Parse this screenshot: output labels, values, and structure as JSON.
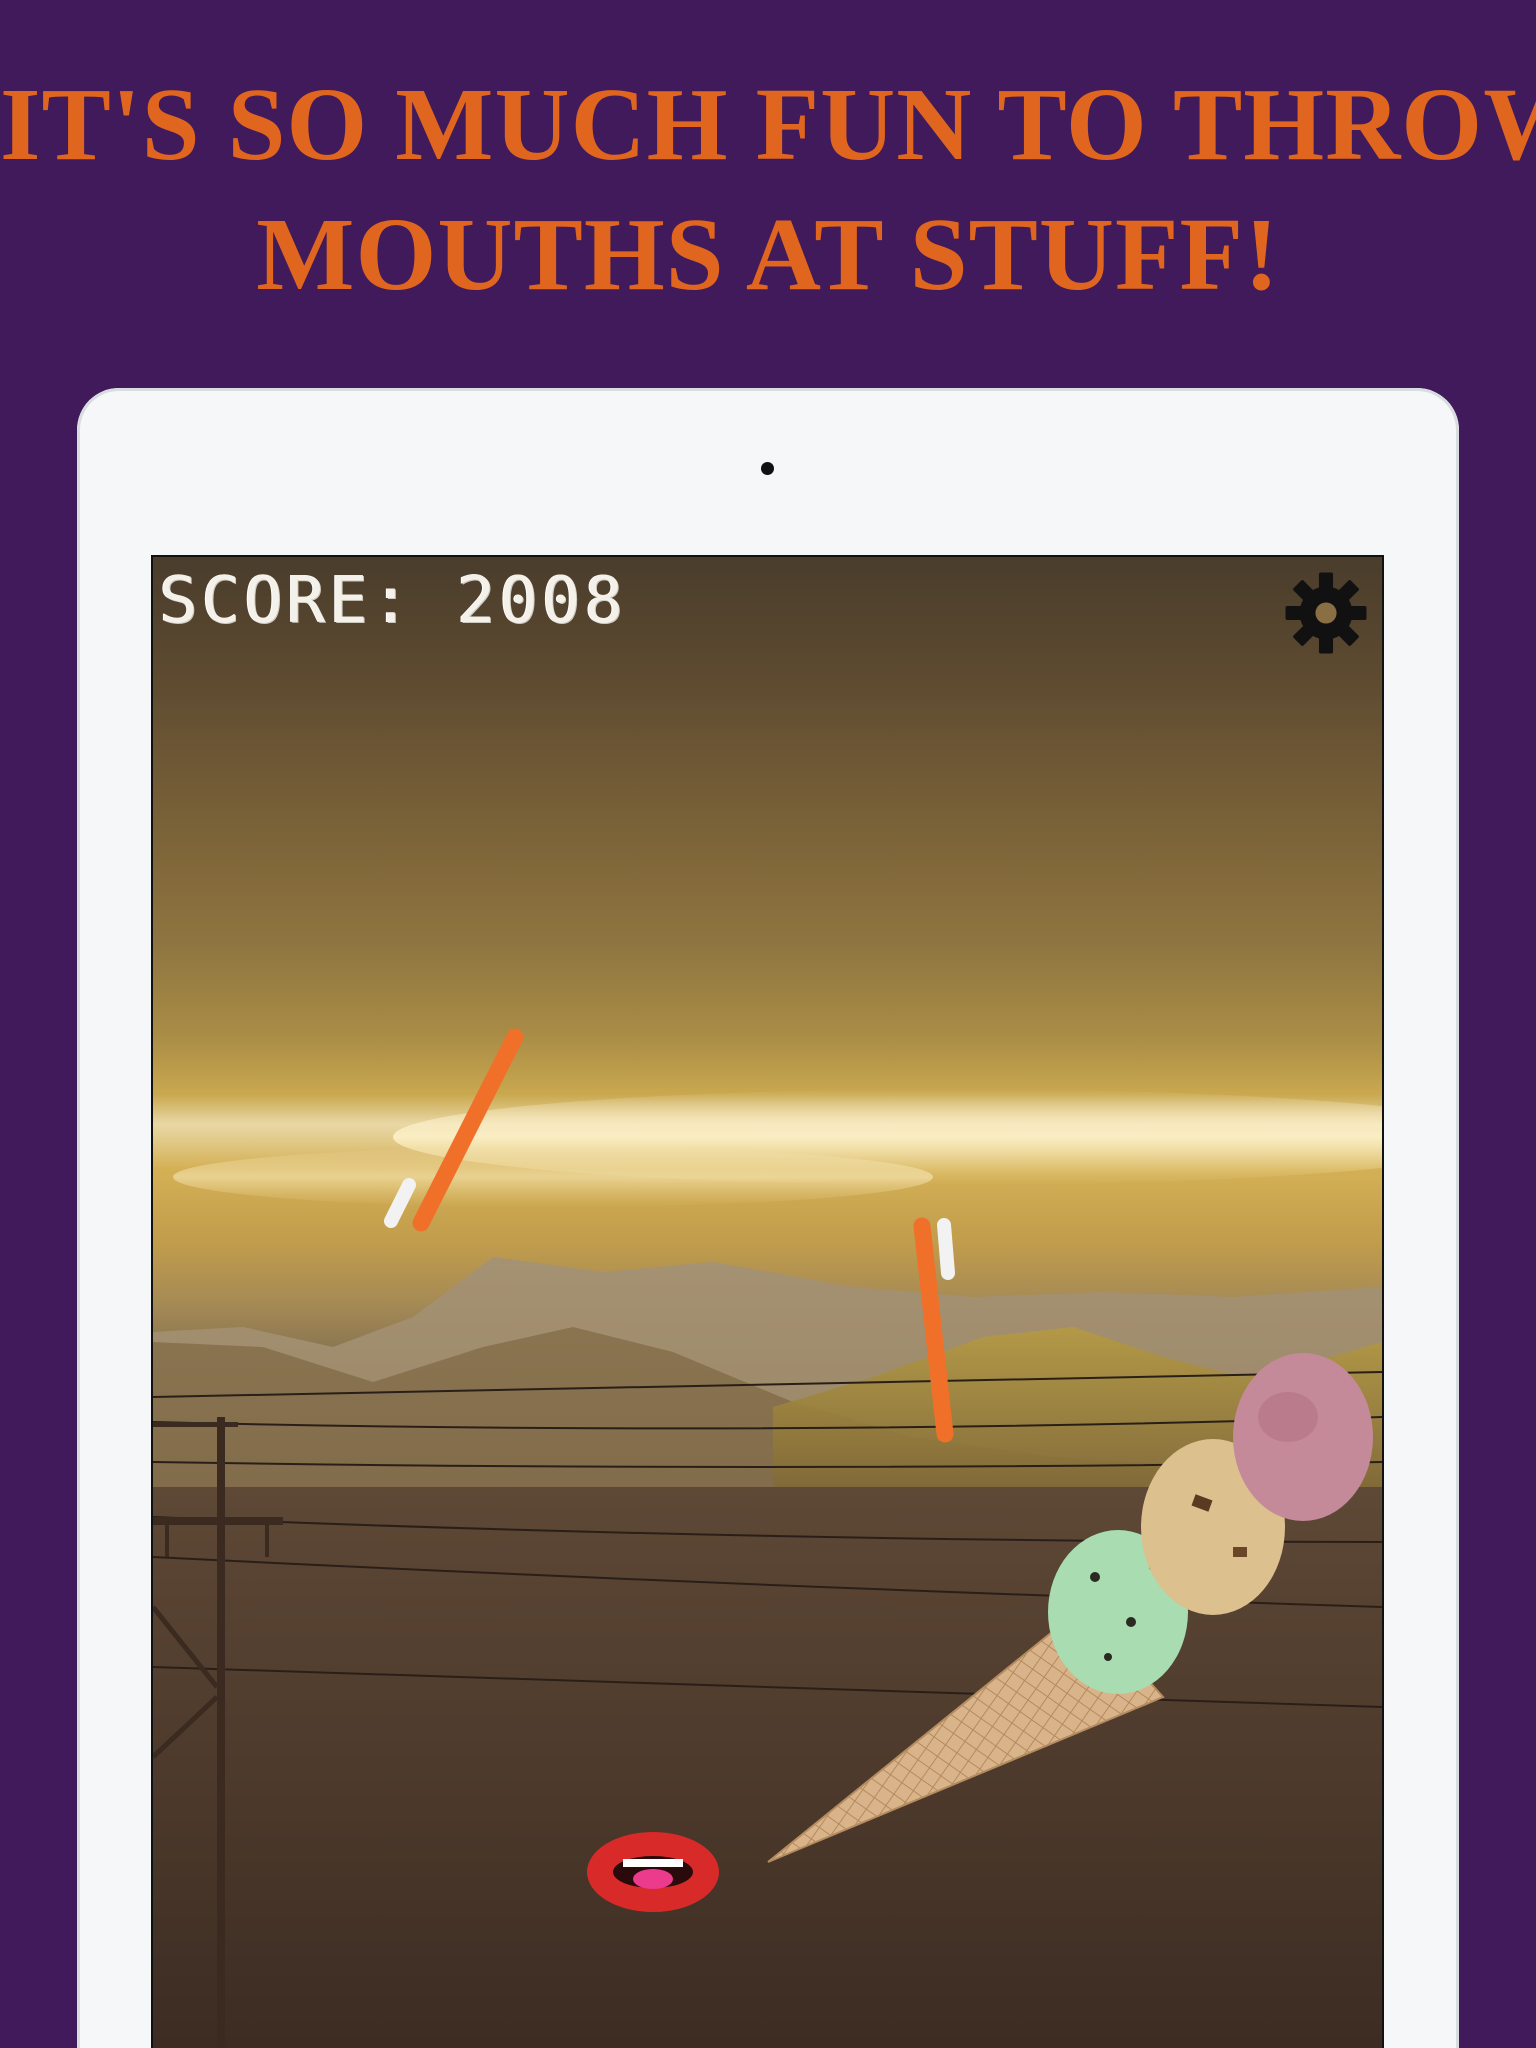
{
  "headline": {
    "line1": "IT'S SO MUCH FUN TO THROW",
    "line2": "MOUTHS AT STUFF!"
  },
  "game": {
    "score_text": "SCORE: 2008",
    "settings_icon": "gear-icon",
    "objects": [
      "toothbrush",
      "toothbrush",
      "ice-cream-cone",
      "mouth"
    ]
  },
  "colors": {
    "background": "#401a5a",
    "headline": "#e0651e",
    "tablet": "#f5f7f8",
    "toothbrush": "#f0702a",
    "lips": "#d92a2a"
  }
}
